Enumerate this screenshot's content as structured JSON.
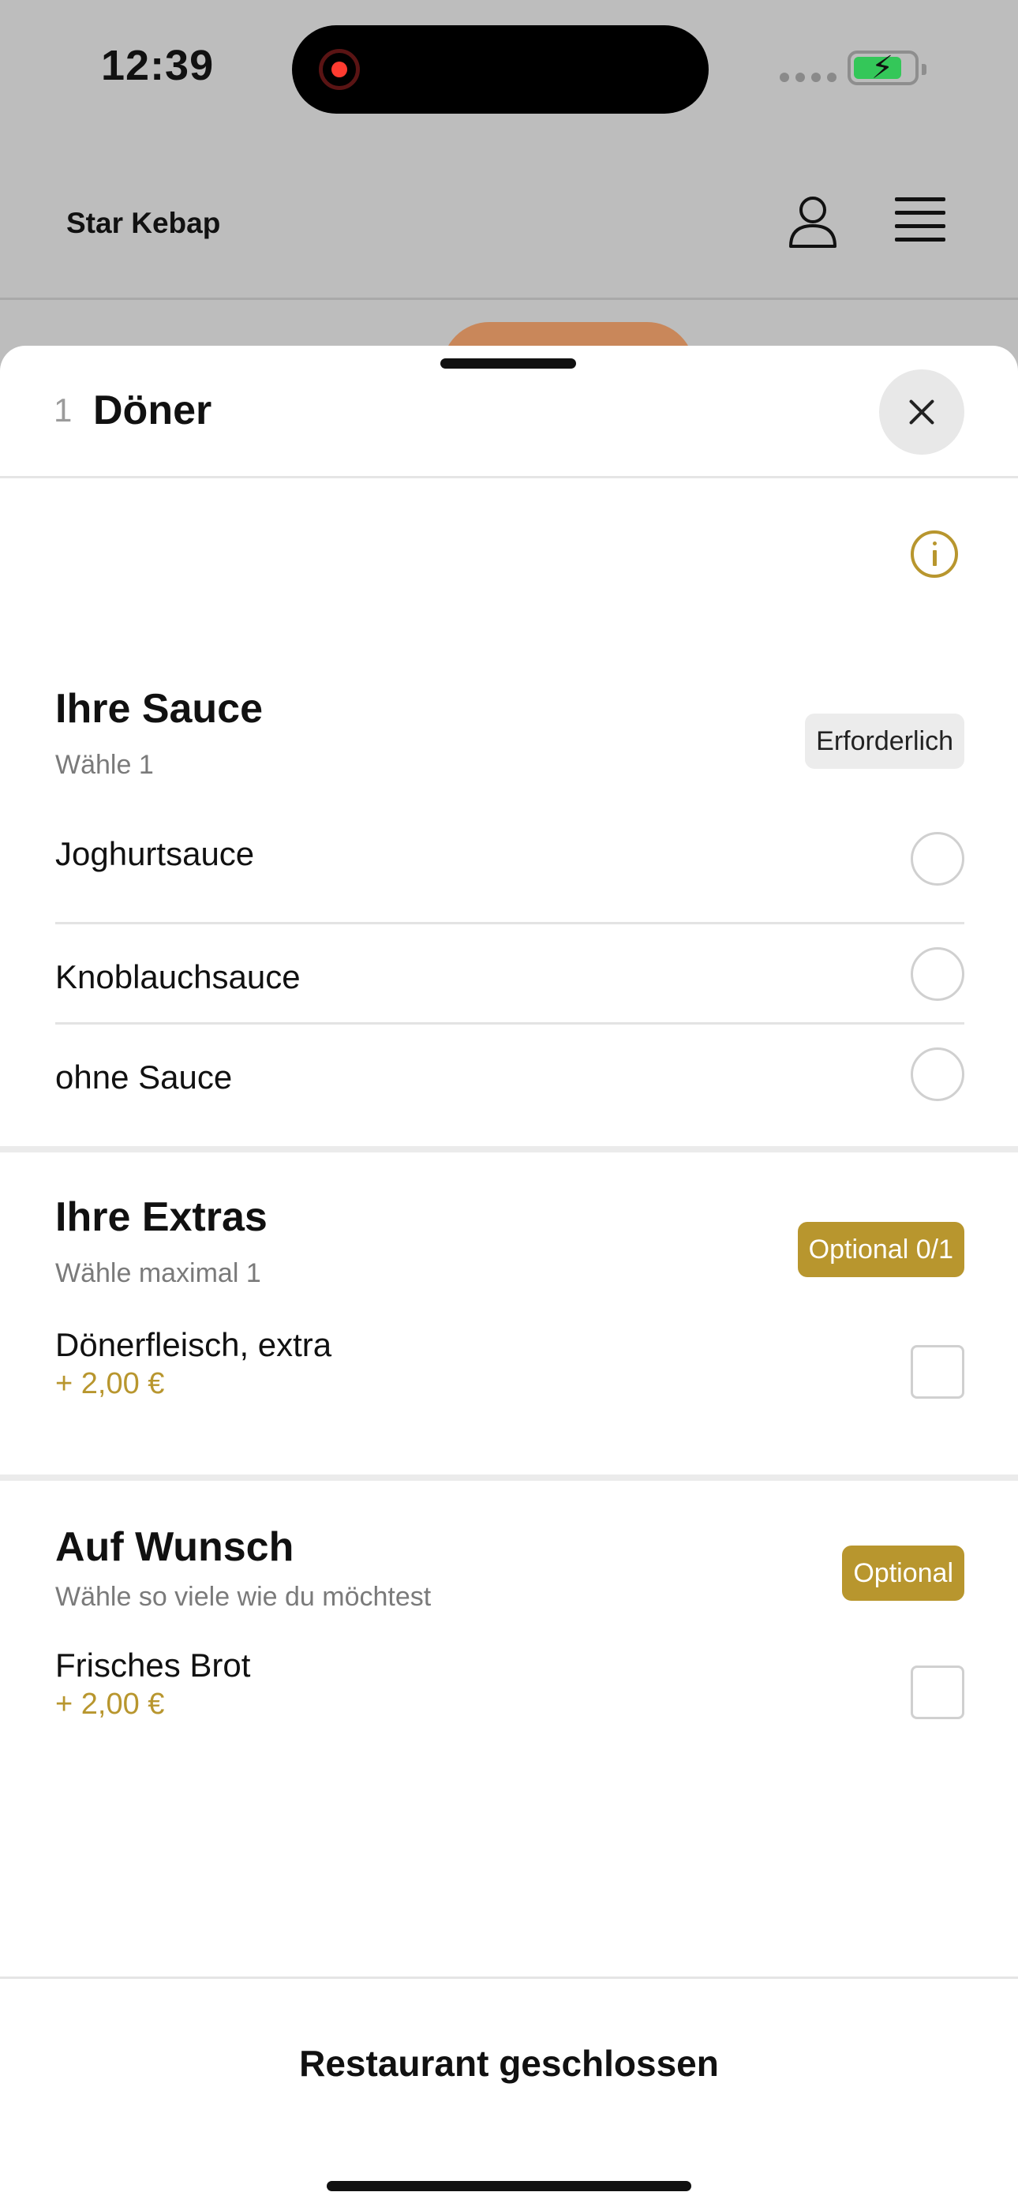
{
  "status_bar": {
    "time": "12:39",
    "battery_color": "#34c759"
  },
  "app_header": {
    "brand": "Star Kebap",
    "user_icon": "user-icon",
    "menu_icon": "menu-icon"
  },
  "sheet": {
    "quantity": "1",
    "title": "Döner",
    "close_icon": "close-icon",
    "info_icon": "info-icon"
  },
  "sections": {
    "sauce": {
      "title": "Ihre Sauce",
      "subtitle": "Wähle 1",
      "badge": "Erforderlich",
      "options": [
        {
          "label": "Joghurtsauce"
        },
        {
          "label": "Knoblauchsauce"
        },
        {
          "label": "ohne Sauce"
        }
      ]
    },
    "extras": {
      "title": "Ihre Extras",
      "subtitle": "Wähle maximal 1",
      "badge": "Optional 0/1",
      "options": [
        {
          "label": "Dönerfleisch, extra",
          "price": "+ 2,00 €"
        }
      ]
    },
    "wish": {
      "title": "Auf Wunsch",
      "subtitle": "Wähle so viele wie du möchtest",
      "badge": "Optional",
      "options": [
        {
          "label": "Frisches Brot",
          "price": "+ 2,00 €"
        }
      ]
    }
  },
  "footer": {
    "button_label": "Restaurant geschlossen"
  },
  "colors": {
    "accent": "#b8962e",
    "text": "#111111",
    "muted": "#7a7a7a"
  }
}
